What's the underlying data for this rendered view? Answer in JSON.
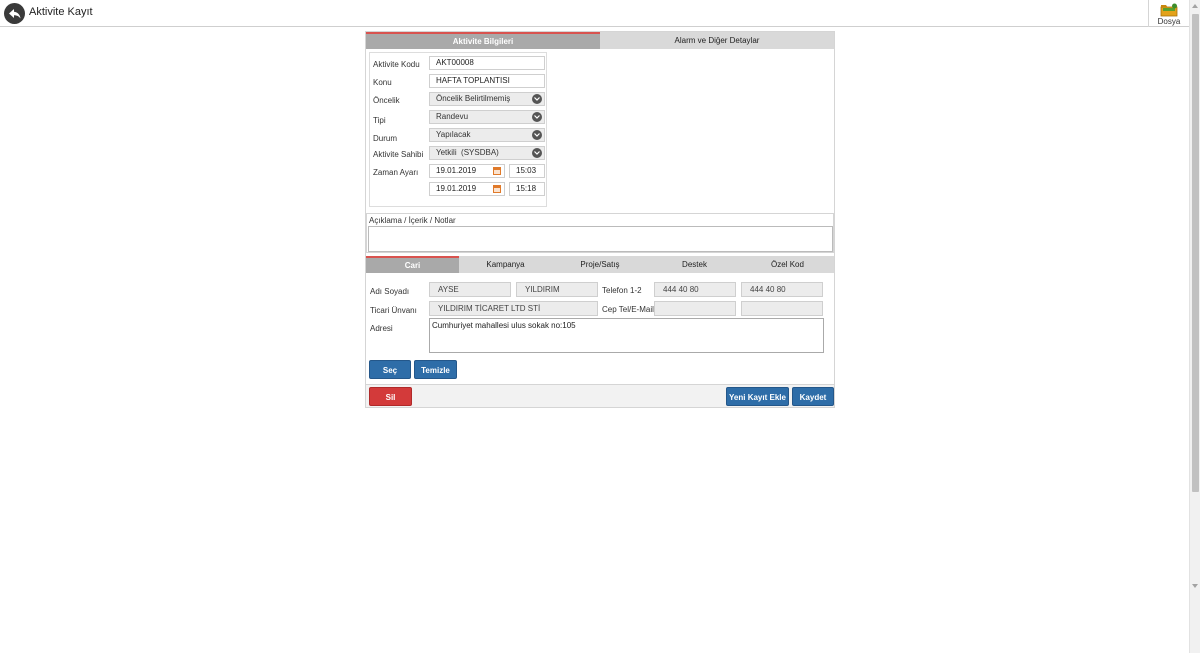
{
  "header": {
    "title": "Aktivite Kayıt",
    "file_label": "Dosya"
  },
  "top_tabs": [
    {
      "label": "Aktivite Bilgileri",
      "active": true
    },
    {
      "label": "Alarm ve Diğer Detaylar",
      "active": false
    }
  ],
  "form": {
    "activity_code": {
      "label": "Aktivite Kodu",
      "value": "AKT00008"
    },
    "subject": {
      "label": "Konu",
      "value": "HAFTA TOPLANTISI"
    },
    "priority": {
      "label": "Öncelik",
      "value": "Öncelik Belirtilmemiş"
    },
    "type": {
      "label": "Tipi",
      "value": "Randevu"
    },
    "status": {
      "label": "Durum",
      "value": "Yapılacak"
    },
    "owner": {
      "label": "Aktivite Sahibi",
      "value": "Yetkili  (SYSDBA)"
    },
    "time": {
      "label": "Zaman Ayarı",
      "start_date": "19.01.2019",
      "start_time": "15:03",
      "end_date": "19.01.2019",
      "end_time": "15:18"
    }
  },
  "notes": {
    "label": "Açıklama / İçerik / Notlar",
    "value": ""
  },
  "sub_tabs": [
    {
      "label": "Cari",
      "active": true
    },
    {
      "label": "Kampanya",
      "active": false
    },
    {
      "label": "Proje/Satış",
      "active": false
    },
    {
      "label": "Destek",
      "active": false
    },
    {
      "label": "Özel Kod",
      "active": false
    }
  ],
  "cari": {
    "name_label": "Adı Soyadı",
    "first_name": "AYSE",
    "last_name": "YILDIRIM",
    "phone_label": "Telefon 1-2",
    "phone1": "444 40 80",
    "phone2": "444 40 80",
    "company_label": "Ticari Ünvanı",
    "company": "YILDIRIM TİCARET LTD STİ",
    "mobile_label": "Cep Tel/E-Mail",
    "mobile": "",
    "email": "",
    "address_label": "Adresi",
    "address": "Cumhuriyet mahallesi ulus sokak no:105",
    "select_button": "Seç",
    "clear_button": "Temizle"
  },
  "footer": {
    "delete_button": "Sil",
    "new_record_button": "Yeni Kayıt Ekle",
    "save_button": "Kaydet"
  },
  "colors": {
    "primary_button": "#2e6da8",
    "danger_button": "#d33a3a",
    "active_tab": "#a9a9a9",
    "active_tab_accent": "#d9534f"
  }
}
